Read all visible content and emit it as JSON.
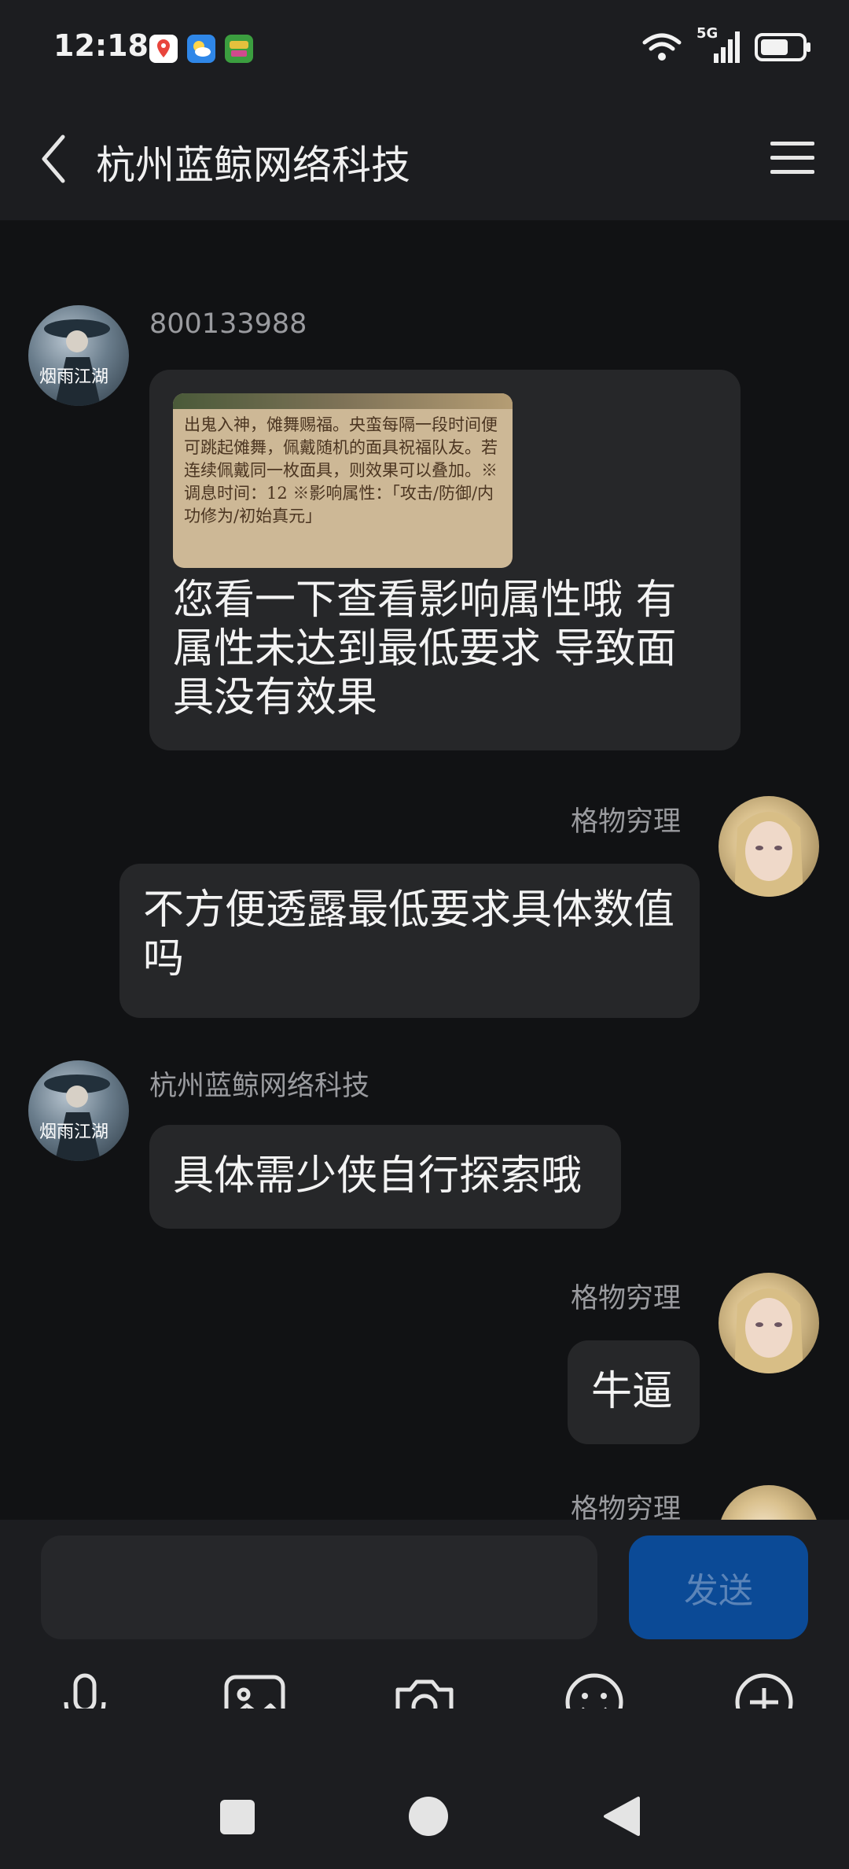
{
  "status_bar": {
    "time": "12:18",
    "network": "5G",
    "icons": [
      "map-pin-app-icon",
      "weather-app-icon",
      "game-app-icon",
      "wifi-icon",
      "signal-icon",
      "battery-icon"
    ]
  },
  "header": {
    "title": "杭州蓝鲸网络科技",
    "back_icon": "chevron-left-icon",
    "menu_icon": "hamburger-menu-icon"
  },
  "messages": [
    {
      "sender": "800133988",
      "side": "left",
      "image_text": "出鬼入神，傩舞赐福。央蛮每隔一段时间便可跳起傩舞，佩戴随机的面具祝福队友。若连续佩戴同一枚面具，则效果可以叠加。※调息时间：12 ※影响属性：「攻击/防御/内功修为/初始真元」",
      "text": "您看一下查看影响属性哦  有属性未达到最低要求 导致面具没有效果"
    },
    {
      "sender": "格物穷理",
      "side": "right",
      "text": "不方便透露最低要求具体数值吗"
    },
    {
      "sender": "杭州蓝鲸网络科技",
      "side": "left",
      "text": "具体需少侠自行探索哦"
    },
    {
      "sender": "格物穷理",
      "side": "right",
      "text": "牛逼"
    },
    {
      "sender": "格物穷理",
      "side": "right",
      "text": ""
    }
  ],
  "composer": {
    "input_value": "",
    "send_label": "发送",
    "tools": [
      "microphone-icon",
      "image-icon",
      "camera-icon",
      "emoji-icon",
      "plus-icon"
    ]
  },
  "nav": [
    "recent-apps-icon",
    "home-icon",
    "back-icon"
  ],
  "colors": {
    "background": "#111214",
    "bar": "#1c1d20",
    "bubble": "#262729",
    "send_button": "#0b4a96"
  }
}
